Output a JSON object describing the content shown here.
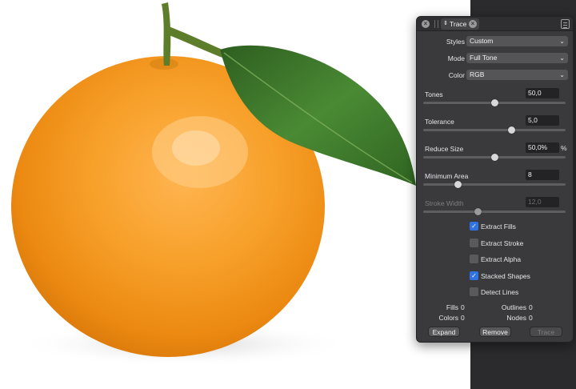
{
  "panel": {
    "tab_title": "Trace",
    "styles": {
      "label": "Styles",
      "value": "Custom"
    },
    "mode": {
      "label": "Mode",
      "value": "Full Tone"
    },
    "color": {
      "label": "Color",
      "value": "RGB"
    },
    "sliders": [
      {
        "label": "Tones",
        "value": "50,0",
        "unit": "",
        "level": 0.5,
        "enabled": true
      },
      {
        "label": "Tolerance",
        "value": "5,0",
        "unit": "",
        "level": 0.62,
        "enabled": true
      },
      {
        "label": "Reduce Size",
        "value": "50,0%",
        "unit": "%",
        "level": 0.5,
        "enabled": true
      },
      {
        "label": "Minimum Area",
        "value": "8",
        "unit": "",
        "level": 0.24,
        "enabled": true
      },
      {
        "label": "Stroke Width",
        "value": "12,0",
        "unit": "",
        "level": 0.38,
        "enabled": false
      }
    ],
    "checkboxes": [
      {
        "label": "Extract Fills",
        "checked": true
      },
      {
        "label": "Extract Stroke",
        "checked": false
      },
      {
        "label": "Extract Alpha",
        "checked": false
      },
      {
        "label": "Stacked Shapes",
        "checked": true
      },
      {
        "label": "Detect Lines",
        "checked": false
      }
    ],
    "stats": {
      "fills_label": "Fills",
      "fills": "0",
      "colors_label": "Colors",
      "colors": "0",
      "outlines_label": "Outlines",
      "outlines": "0",
      "nodes_label": "Nodes",
      "nodes": "0"
    },
    "buttons": {
      "expand": "Expand",
      "remove": "Remove",
      "trace": "Trace"
    }
  },
  "colors": {
    "accent": "#2f72e0",
    "panel_bg": "#3a3a3c",
    "sidebar_bg": "#2b2b2d",
    "orange": "#f59a1e",
    "leaf": "#3f7a2c"
  }
}
